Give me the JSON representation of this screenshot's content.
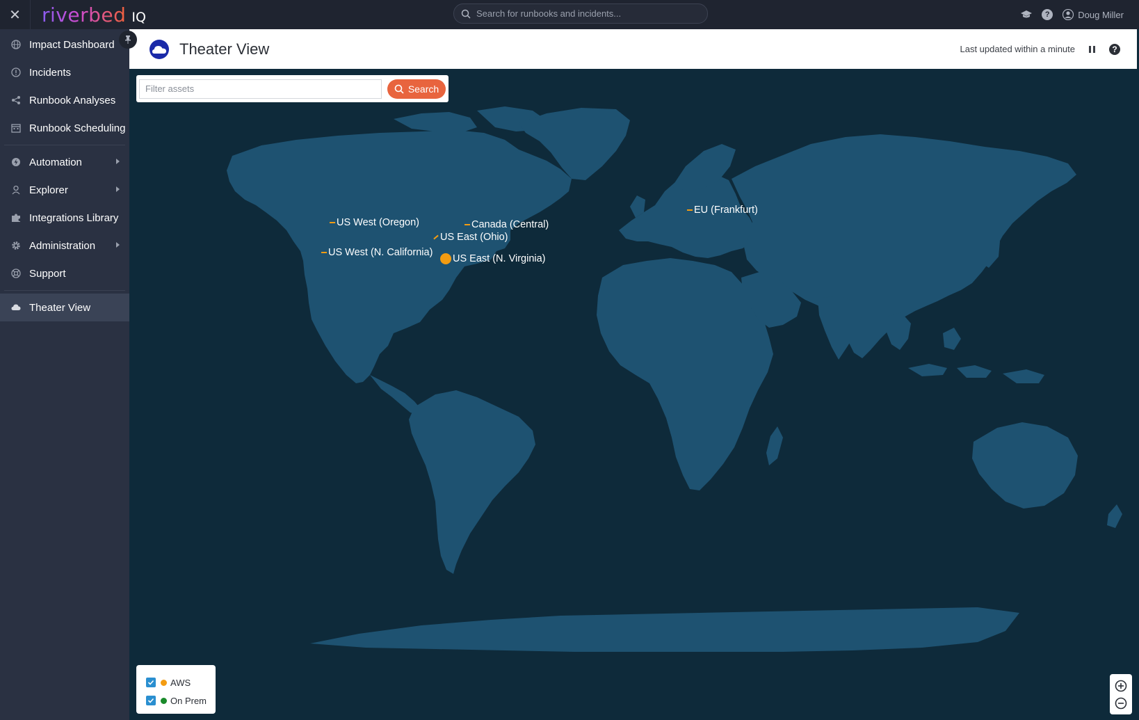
{
  "topbar": {
    "brand_word": "riverbed",
    "brand_suffix": "IQ",
    "search_placeholder": "Search for runbooks and incidents...",
    "user_name": "Doug Miller"
  },
  "sidebar": {
    "items": [
      {
        "label": "Impact Dashboard",
        "icon": "globe-icon"
      },
      {
        "label": "Incidents",
        "icon": "alert-circle-icon"
      },
      {
        "label": "Runbook Analyses",
        "icon": "share-nodes-icon"
      },
      {
        "label": "Runbook Scheduling",
        "icon": "calendar-icon"
      },
      {
        "label": "Automation",
        "icon": "robot-icon"
      },
      {
        "label": "Explorer",
        "icon": "explorer-icon"
      },
      {
        "label": "Integrations Library",
        "icon": "puzzle-icon"
      },
      {
        "label": "Administration",
        "icon": "gear-icon"
      },
      {
        "label": "Support",
        "icon": "lifebuoy-icon"
      },
      {
        "label": "Theater View",
        "icon": "cloud-icon"
      }
    ]
  },
  "header": {
    "title": "Theater View",
    "last_updated": "Last updated within a minute"
  },
  "filter": {
    "placeholder": "Filter assets",
    "search_label": "Search"
  },
  "regions": [
    {
      "label": "US West (Oregon)"
    },
    {
      "label": "Canada (Central)"
    },
    {
      "label": "US East (Ohio)"
    },
    {
      "label": "US West (N. California)"
    },
    {
      "label": "US East (N. Virginia)"
    },
    {
      "label": "EU (Frankfurt)"
    }
  ],
  "legend": {
    "items": [
      {
        "label": "AWS",
        "color": "#f39c12",
        "checked": true
      },
      {
        "label": "On Prem",
        "color": "#1a8a2a",
        "checked": true
      }
    ]
  },
  "colors": {
    "ocean": "#0e2a3a",
    "land": "#1e5271",
    "accent": "#e8643e",
    "aws_marker": "#f39c12",
    "sidebar_bg": "#2a3142",
    "topbar_bg": "#1f2430"
  }
}
